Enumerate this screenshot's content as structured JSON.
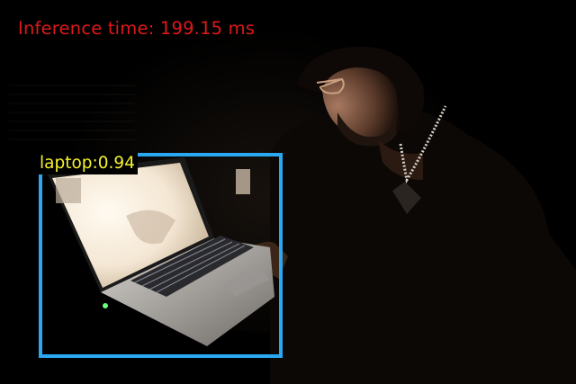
{
  "inference": {
    "text": "Inference time: 199.15 ms",
    "color": "#e01818"
  },
  "detection": {
    "label": "laptop:0.94",
    "label_color": "#f6f22a",
    "box_color": "#2aa8f2"
  }
}
